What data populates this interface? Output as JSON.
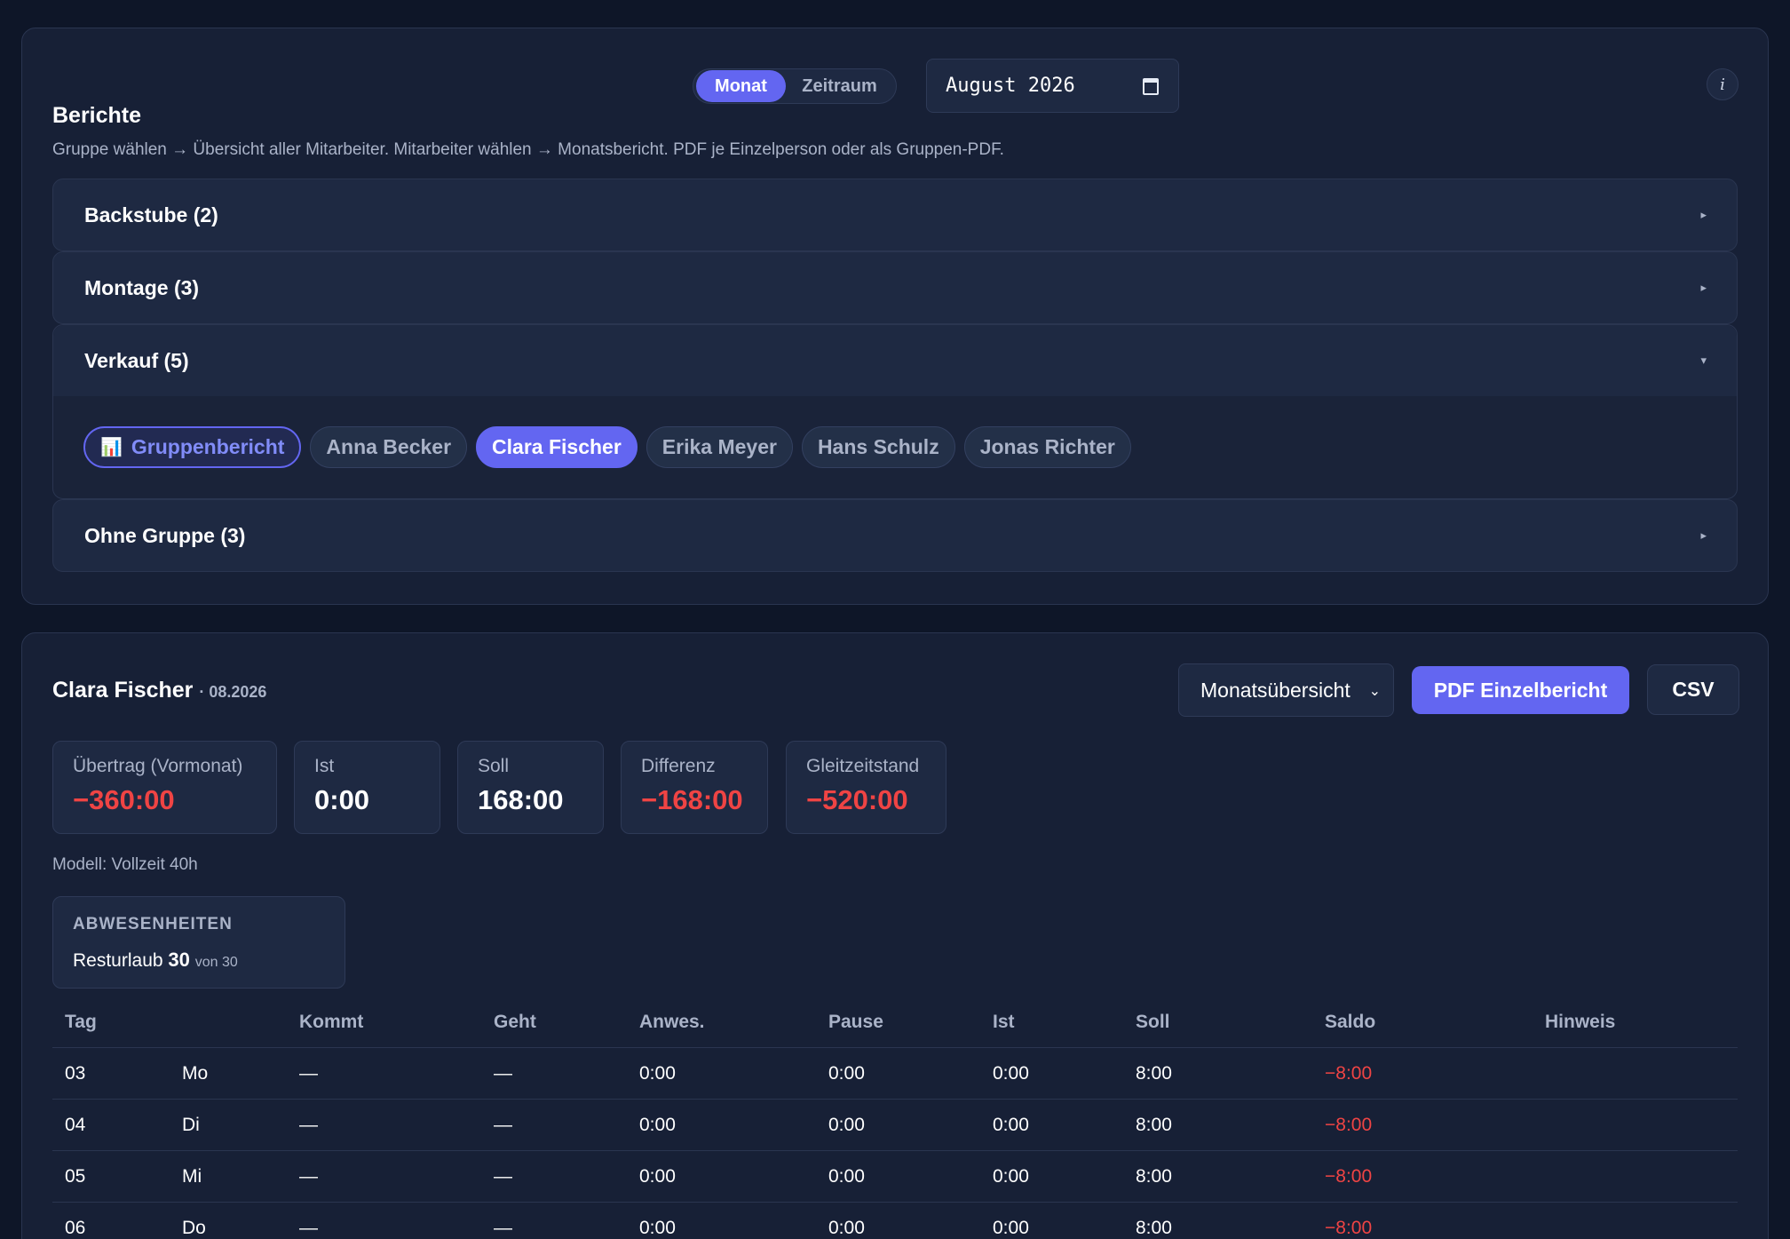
{
  "reports": {
    "title": "Berichte",
    "mode_tabs": [
      {
        "label": "Monat",
        "active": true
      },
      {
        "label": "Zeitraum",
        "active": false
      }
    ],
    "month_value": "August 2026",
    "info_label": "i",
    "hint": "Gruppe wählen → Übersicht aller Mitarbeiter. Mitarbeiter wählen → Monatsbericht. PDF je Einzelperson oder als Gruppen-PDF.",
    "groups": [
      {
        "title": "Backstube (2)",
        "caret": "▸"
      },
      {
        "title": "Montage (3)",
        "caret": "▸"
      },
      {
        "title": "Verkauf (5)",
        "caret": "▾"
      },
      {
        "title": "Ohne Gruppe (3)",
        "caret": "▸"
      }
    ],
    "verkauf_members": {
      "group_report_icon": "📊",
      "group_report_label": "Gruppenbericht",
      "people": [
        "Anna Becker",
        "Clara Fischer",
        "Erika Meyer",
        "Hans Schulz",
        "Jonas Richter"
      ],
      "selected": "Clara Fischer"
    }
  },
  "person": {
    "name": "Clara Fischer",
    "period": "· 08.2026",
    "view_select": "Monatsübersicht",
    "pdf_button": "PDF Einzelbericht",
    "csv_button": "CSV",
    "stats": [
      {
        "label": "Übertrag (Vormonat)",
        "value": "−360:00",
        "negative": true
      },
      {
        "label": "Ist",
        "value": "0:00",
        "negative": false
      },
      {
        "label": "Soll",
        "value": "168:00",
        "negative": false
      },
      {
        "label": "Differenz",
        "value": "−168:00",
        "negative": true
      },
      {
        "label": "Gleitzeitstand",
        "value": "−520:00",
        "negative": true
      }
    ],
    "model": "Modell: Vollzeit 40h",
    "absences": {
      "heading": "ABWESENHEITEN",
      "vacation_label": "Resturlaub",
      "vacation_value": "30",
      "vacation_total": "von 30"
    },
    "table": {
      "columns": [
        "Tag",
        "",
        "Kommt",
        "Geht",
        "Anwes.",
        "Pause",
        "Ist",
        "Soll",
        "Saldo",
        "Hinweis"
      ],
      "rows": [
        [
          "03",
          "Mo",
          "—",
          "—",
          "0:00",
          "0:00",
          "0:00",
          "8:00",
          "−8:00",
          ""
        ],
        [
          "04",
          "Di",
          "—",
          "—",
          "0:00",
          "0:00",
          "0:00",
          "8:00",
          "−8:00",
          ""
        ],
        [
          "05",
          "Mi",
          "—",
          "—",
          "0:00",
          "0:00",
          "0:00",
          "8:00",
          "−8:00",
          ""
        ],
        [
          "06",
          "Do",
          "—",
          "—",
          "0:00",
          "0:00",
          "0:00",
          "8:00",
          "−8:00",
          ""
        ]
      ]
    }
  },
  "colors": {
    "accent": "#6366f1",
    "negative": "#ef4444",
    "background": "#0e1628",
    "card": "#172036"
  }
}
